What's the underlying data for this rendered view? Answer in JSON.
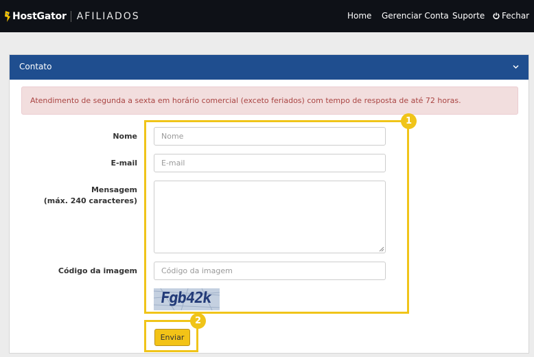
{
  "header": {
    "brand": "HostGator",
    "product": "AFILIADOS",
    "nav": {
      "home": "Home",
      "account": "Gerenciar Conta",
      "support": "Suporte",
      "logout": "Fechar"
    }
  },
  "panel": {
    "title": "Contato",
    "alert": "Atendimento de segunda a sexta em horário comercial (exceto feriados) com tempo de resposta de até 72 horas."
  },
  "form": {
    "name_label": "Nome",
    "name_placeholder": "Nome",
    "email_label": "E-mail",
    "email_placeholder": "E-mail",
    "message_label_line1": "Mensagem",
    "message_label_line2": "(máx. 240 caracteres)",
    "code_label": "Código da imagem",
    "code_placeholder": "Código da imagem",
    "captcha_text": "Fgb42k",
    "submit_label": "Enviar"
  },
  "annotations": {
    "badge1": "1",
    "badge2": "2",
    "highlight_color": "#f0c419"
  },
  "colors": {
    "topbar": "#0e1117",
    "panel_header": "#1f4e8f",
    "alert_bg": "#f2dede",
    "alert_text": "#a94442",
    "button": "#f3c317"
  }
}
